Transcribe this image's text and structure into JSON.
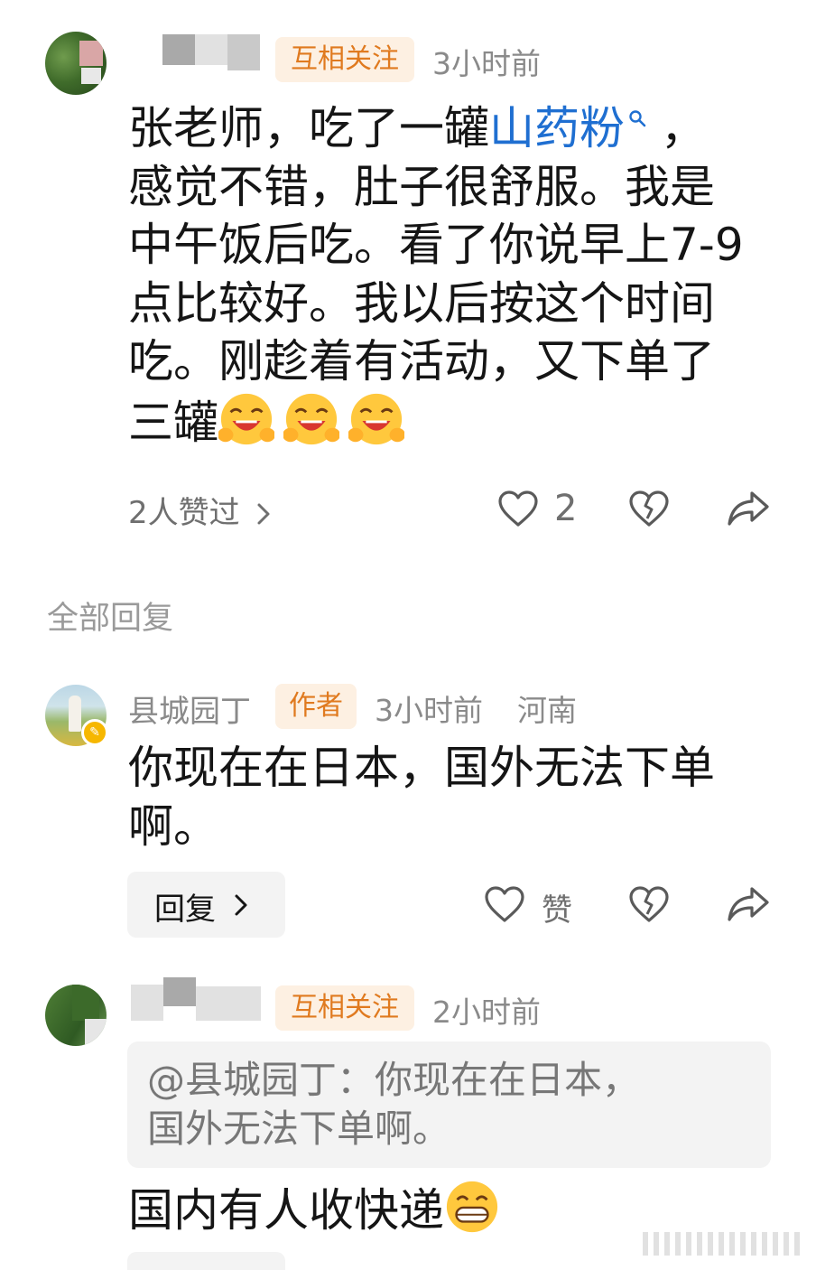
{
  "comment1": {
    "mutual_badge": "互相关注",
    "time": "3小时前",
    "text_before_link": "张老师，吃了一罐",
    "link_text": "山药粉",
    "text_line1_after": " ，",
    "text_line2": "感觉不错，肚子很舒服。我是",
    "text_line3": "中午饭后吃。看了你说早上7-9",
    "text_line4": "点比较好。我以后按这个时间",
    "text_line5": "吃。刚趁着有活动，又下单了",
    "text_line6": "三罐",
    "liked_by": "2人赞过",
    "like_count": "2"
  },
  "section_title": "全部回复",
  "reply1": {
    "author": "县城园丁",
    "author_badge": "作者",
    "time": "3小时前",
    "location": "河南",
    "text_line1": "你现在在日本，国外无法下单",
    "text_line2": "啊。",
    "reply_button": "回复",
    "like_label": "赞"
  },
  "reply2": {
    "mutual_badge": "互相关注",
    "time": "2小时前",
    "quote_line1": "@县城园丁：你现在在日本，",
    "quote_line2": "国外无法下单啊。",
    "text": "国内有人收快递"
  },
  "icons": {
    "like": "heart-outline-icon",
    "dislike": "broken-heart-icon",
    "share": "share-arrow-icon",
    "chevron": "chevron-right-icon",
    "search": "search-icon"
  },
  "colors": {
    "badge_bg": "#fdf0e2",
    "badge_text": "#e07a1f",
    "link": "#1f6fd1",
    "meta": "#8a8a8a"
  }
}
